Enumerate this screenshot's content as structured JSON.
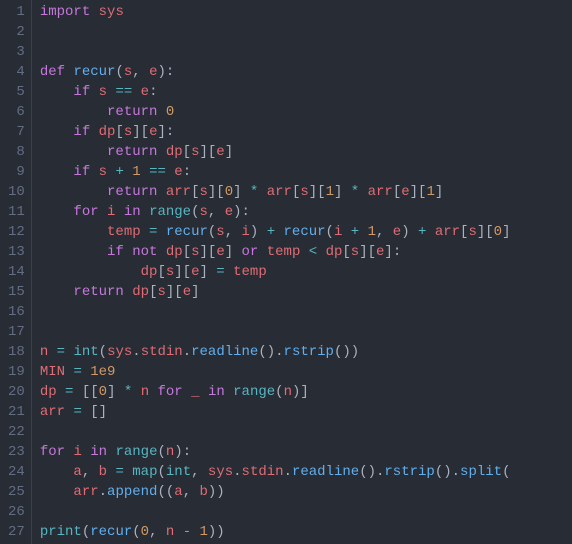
{
  "lines": [
    {
      "n": "1",
      "html": "<span class='kw'>import</span> <span class='id'>sys</span>"
    },
    {
      "n": "2",
      "html": ""
    },
    {
      "n": "3",
      "html": ""
    },
    {
      "n": "4",
      "html": "<span class='kw'>def</span> <span class='fn'>recur</span><span class='p'>(</span><span class='id'>s</span><span class='p'>,</span> <span class='id'>e</span><span class='p'>):</span>"
    },
    {
      "n": "5",
      "html": "    <span class='kw'>if</span> <span class='id'>s</span> <span class='op'>==</span> <span class='id'>e</span><span class='p'>:</span>"
    },
    {
      "n": "6",
      "html": "        <span class='kw'>return</span> <span class='num'>0</span>"
    },
    {
      "n": "7",
      "html": "    <span class='kw'>if</span> <span class='id'>dp</span><span class='p'>[</span><span class='id'>s</span><span class='p'>][</span><span class='id'>e</span><span class='p'>]:</span>"
    },
    {
      "n": "8",
      "html": "        <span class='kw'>return</span> <span class='id'>dp</span><span class='p'>[</span><span class='id'>s</span><span class='p'>][</span><span class='id'>e</span><span class='p'>]</span>"
    },
    {
      "n": "9",
      "html": "    <span class='kw'>if</span> <span class='id'>s</span> <span class='op'>+</span> <span class='num'>1</span> <span class='op'>==</span> <span class='id'>e</span><span class='p'>:</span>"
    },
    {
      "n": "10",
      "html": "        <span class='kw'>return</span> <span class='id'>arr</span><span class='p'>[</span><span class='id'>s</span><span class='p'>][</span><span class='num'>0</span><span class='p'>]</span> <span class='op'>*</span> <span class='id'>arr</span><span class='p'>[</span><span class='id'>s</span><span class='p'>][</span><span class='num'>1</span><span class='p'>]</span> <span class='op'>*</span> <span class='id'>arr</span><span class='p'>[</span><span class='id'>e</span><span class='p'>][</span><span class='num'>1</span><span class='p'>]</span>"
    },
    {
      "n": "11",
      "html": "    <span class='kw'>for</span> <span class='id'>i</span> <span class='kw'>in</span> <span class='bi'>range</span><span class='p'>(</span><span class='id'>s</span><span class='p'>,</span> <span class='id'>e</span><span class='p'>):</span>"
    },
    {
      "n": "12",
      "html": "        <span class='id'>temp</span> <span class='op'>=</span> <span class='fn'>recur</span><span class='p'>(</span><span class='id'>s</span><span class='p'>,</span> <span class='id'>i</span><span class='p'>)</span> <span class='op'>+</span> <span class='fn'>recur</span><span class='p'>(</span><span class='id'>i</span> <span class='op'>+</span> <span class='num'>1</span><span class='p'>,</span> <span class='id'>e</span><span class='p'>)</span> <span class='op'>+</span> <span class='id'>arr</span><span class='p'>[</span><span class='id'>s</span><span class='p'>][</span><span class='num'>0</span><span class='p'>]</span>"
    },
    {
      "n": "13",
      "html": "        <span class='kw'>if</span> <span class='kw'>not</span> <span class='id'>dp</span><span class='p'>[</span><span class='id'>s</span><span class='p'>][</span><span class='id'>e</span><span class='p'>]</span> <span class='kw'>or</span> <span class='id'>temp</span> <span class='op'>&lt;</span> <span class='id'>dp</span><span class='p'>[</span><span class='id'>s</span><span class='p'>][</span><span class='id'>e</span><span class='p'>]:</span>"
    },
    {
      "n": "14",
      "html": "            <span class='id'>dp</span><span class='p'>[</span><span class='id'>s</span><span class='p'>][</span><span class='id'>e</span><span class='p'>]</span> <span class='op'>=</span> <span class='id'>temp</span>"
    },
    {
      "n": "15",
      "html": "    <span class='kw'>return</span> <span class='id'>dp</span><span class='p'>[</span><span class='id'>s</span><span class='p'>][</span><span class='id'>e</span><span class='p'>]</span>"
    },
    {
      "n": "16",
      "html": ""
    },
    {
      "n": "17",
      "html": ""
    },
    {
      "n": "18",
      "html": "<span class='id'>n</span> <span class='op'>=</span> <span class='bi'>int</span><span class='p'>(</span><span class='id'>sys</span><span class='p'>.</span><span class='id'>stdin</span><span class='p'>.</span><span class='fn'>readline</span><span class='p'>().</span><span class='fn'>rstrip</span><span class='p'>())</span>"
    },
    {
      "n": "19",
      "html": "<span class='id'>MIN</span> <span class='op'>=</span> <span class='num'>1e9</span>"
    },
    {
      "n": "20",
      "html": "<span class='id'>dp</span> <span class='op'>=</span> <span class='p'>[[</span><span class='num'>0</span><span class='p'>]</span> <span class='op'>*</span> <span class='id'>n</span> <span class='kw'>for</span> <span class='id'>_</span> <span class='kw'>in</span> <span class='bi'>range</span><span class='p'>(</span><span class='id'>n</span><span class='p'>)]</span>"
    },
    {
      "n": "21",
      "html": "<span class='id'>arr</span> <span class='op'>=</span> <span class='p'>[]</span>"
    },
    {
      "n": "22",
      "html": ""
    },
    {
      "n": "23",
      "html": "<span class='kw'>for</span> <span class='id'>i</span> <span class='kw'>in</span> <span class='bi'>range</span><span class='p'>(</span><span class='id'>n</span><span class='p'>):</span>"
    },
    {
      "n": "24",
      "html": "    <span class='id'>a</span><span class='p'>,</span> <span class='id'>b</span> <span class='op'>=</span> <span class='bi'>map</span><span class='p'>(</span><span class='bi'>int</span><span class='p'>,</span> <span class='id'>sys</span><span class='p'>.</span><span class='id'>stdin</span><span class='p'>.</span><span class='fn'>readline</span><span class='p'>().</span><span class='fn'>rstrip</span><span class='p'>().</span><span class='fn'>split</span><span class='p'>(</span>"
    },
    {
      "n": "25",
      "html": "    <span class='id'>arr</span><span class='p'>.</span><span class='fn'>append</span><span class='p'>((</span><span class='id'>a</span><span class='p'>,</span> <span class='id'>b</span><span class='p'>))</span>"
    },
    {
      "n": "26",
      "html": ""
    },
    {
      "n": "27",
      "html": "<span class='bi'>print</span><span class='p'>(</span><span class='fn'>recur</span><span class='p'>(</span><span class='num'>0</span><span class='p'>,</span> <span class='id'>n</span> <span class='op'>-</span> <span class='num'>1</span><span class='p'>))</span>"
    }
  ]
}
